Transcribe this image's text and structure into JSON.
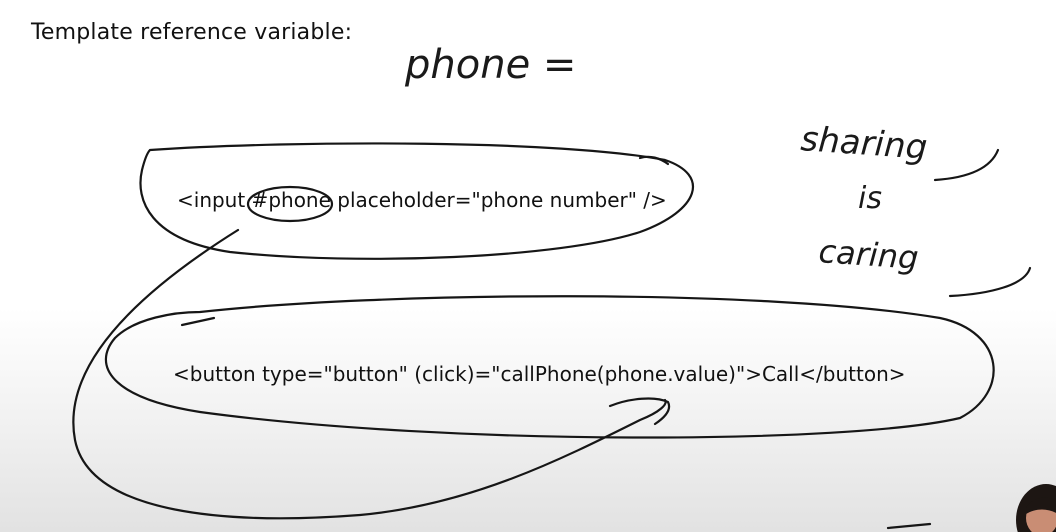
{
  "whiteboard": {
    "heading": "Template reference variable:",
    "scribble_phone": "phone =",
    "code_input": "<input #phone placeholder=\"phone number\" />",
    "code_button": "<button type=\"button\" (click)=\"callPhone(phone.value)\">Call</button>",
    "note_line1": "sharing",
    "note_line2": "is",
    "note_line3": "caring"
  },
  "colors": {
    "ink": "#161616",
    "background": "#ffffff"
  },
  "webcam": {
    "icon": "presenter-webcam-thumbnail"
  }
}
